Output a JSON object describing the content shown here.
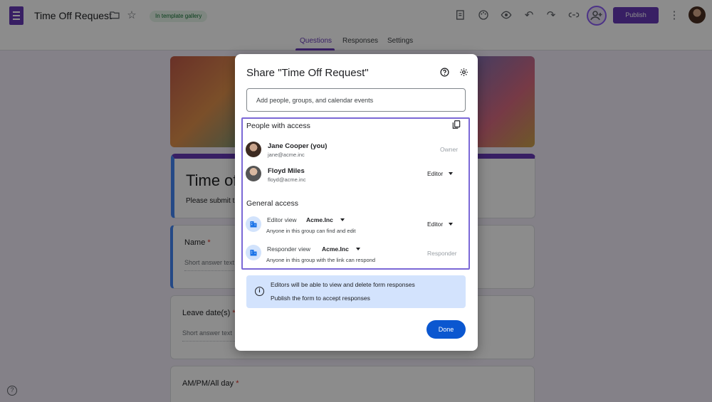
{
  "app": {
    "doc_title": "Time Off Request",
    "template_chip": "In template gallery",
    "publish_label": "Publish",
    "tabs": [
      {
        "label": "Questions"
      },
      {
        "label": "Responses"
      },
      {
        "label": "Settings"
      }
    ],
    "form": {
      "title": "Time of",
      "description": "Please submit th",
      "questions": [
        {
          "label": "Name",
          "placeholder": "Short answer text"
        },
        {
          "label": "Leave date(s)",
          "placeholder": "Short answer text"
        },
        {
          "label": "AM/PM/All day"
        }
      ],
      "required_mark": "*"
    }
  },
  "dialog": {
    "title": "Share \"Time Off Request\"",
    "add_placeholder": "Add people, groups, and calendar events",
    "people_heading": "People with access",
    "people": [
      {
        "name": "Jane Cooper (you)",
        "email": "jane@acme.inc",
        "role": "Owner"
      },
      {
        "name": "Floyd Miles",
        "email": "floyd@acme.inc",
        "role": "Editor"
      }
    ],
    "general_heading": "General access",
    "general": [
      {
        "label": "Editor view",
        "org": "Acme.Inc",
        "desc": "Anyone in this group can find and edit",
        "role": "Editor"
      },
      {
        "label": "Responder view",
        "org": "Acme.Inc",
        "desc": "Anyone in this group with the link can respond",
        "role": "Responder"
      }
    ],
    "info_lines": [
      "Editors will be able to view and delete form responses",
      "Publish the form to accept responses"
    ],
    "done_label": "Done"
  },
  "colors": {
    "brand": "#673ab7",
    "primary_button": "#0b57d0",
    "info_bg": "#d3e3fd",
    "highlight_border": "#7b68d6"
  },
  "icons": [
    "forms-logo-icon",
    "folder-icon",
    "star-icon",
    "customize-icon",
    "palette-icon",
    "preview-eye-icon",
    "undo-icon",
    "redo-icon",
    "link-icon",
    "add-person-icon",
    "more-vert-icon",
    "help-icon",
    "settings-gear-icon",
    "copy-icon",
    "domain-building-icon",
    "info-icon"
  ]
}
